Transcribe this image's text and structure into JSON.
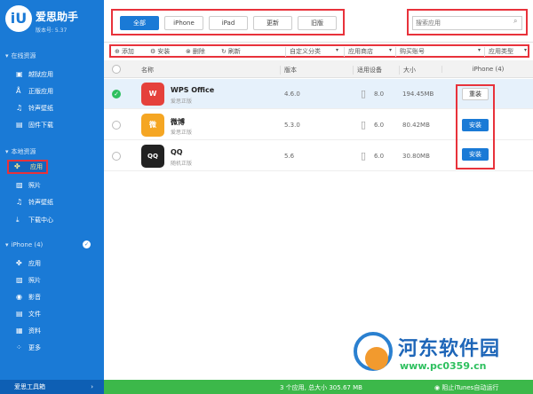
{
  "app": {
    "logo": "iU",
    "name": "爱思助手",
    "version": "版本号: 5.37"
  },
  "sidebar": {
    "online_section": "在线资源",
    "online_items": [
      {
        "label": "越狱应用",
        "icon": "jailbreak-icon",
        "glyph": "▣"
      },
      {
        "label": "正版应用",
        "icon": "appstore-icon",
        "glyph": "Å"
      },
      {
        "label": "铃声壁纸",
        "icon": "ringtone-icon",
        "glyph": "♫"
      },
      {
        "label": "固件下载",
        "icon": "firmware-icon",
        "glyph": "▤"
      }
    ],
    "local_section": "本地资源",
    "local_items": [
      {
        "label": "应用",
        "icon": "apps-icon",
        "glyph": "✤"
      },
      {
        "label": "照片",
        "icon": "photos-icon",
        "glyph": "▨"
      },
      {
        "label": "铃声壁纸",
        "icon": "ringtone-icon",
        "glyph": "♫"
      },
      {
        "label": "下载中心",
        "icon": "download-icon",
        "glyph": "⤓"
      }
    ],
    "device_section": "iPhone (4)",
    "device_items": [
      {
        "label": "应用",
        "icon": "apps-icon",
        "glyph": "✤"
      },
      {
        "label": "照片",
        "icon": "photos-icon",
        "glyph": "▨"
      },
      {
        "label": "影音",
        "icon": "media-icon",
        "glyph": "◉"
      },
      {
        "label": "文件",
        "icon": "files-icon",
        "glyph": "▤"
      },
      {
        "label": "资料",
        "icon": "data-icon",
        "glyph": "▦"
      },
      {
        "label": "更多",
        "icon": "more-icon",
        "glyph": "⁘"
      }
    ],
    "toolbox": "爱思工具箱"
  },
  "tabs": [
    "全部",
    "iPhone",
    "iPad",
    "更新",
    "旧版"
  ],
  "search": {
    "placeholder": "搜索应用"
  },
  "actions": [
    "添加",
    "安装",
    "删除",
    "刷新"
  ],
  "filters": [
    "自定义分类",
    "应用商店",
    "购买账号",
    "应用类型"
  ],
  "table": {
    "headers": {
      "name": "名称",
      "version": "版本",
      "device": "适用设备",
      "size": "大小",
      "iphone": "iPhone (4)"
    },
    "rows": [
      {
        "name": "WPS Office",
        "sub": "爱思正版",
        "version": "4.6.0",
        "device": "8.0",
        "size": "194.45MB",
        "action": "重装",
        "selected": true,
        "icon_text": "W",
        "icon_color": "#e5413b"
      },
      {
        "name": "微博",
        "sub": "爱思正版",
        "version": "5.3.0",
        "device": "6.0",
        "size": "80.42MB",
        "action": "安装",
        "selected": false,
        "icon_text": "微",
        "icon_color": "#f5a623"
      },
      {
        "name": "QQ",
        "sub": "随机正版",
        "version": "5.6",
        "device": "6.0",
        "size": "30.80MB",
        "action": "安装",
        "selected": false,
        "icon_text": "QQ",
        "icon_color": "#222222"
      }
    ]
  },
  "status": {
    "summary": "3 个应用, 总大小 305.67 MB",
    "itunes": "阻止iTunes自动运行"
  },
  "watermark": {
    "title": "河东软件园",
    "url": "www.pc0359.cn"
  },
  "colors": {
    "primary": "#1a7ad6",
    "highlight": "#e8323b",
    "status_bar": "#3cb84a"
  }
}
